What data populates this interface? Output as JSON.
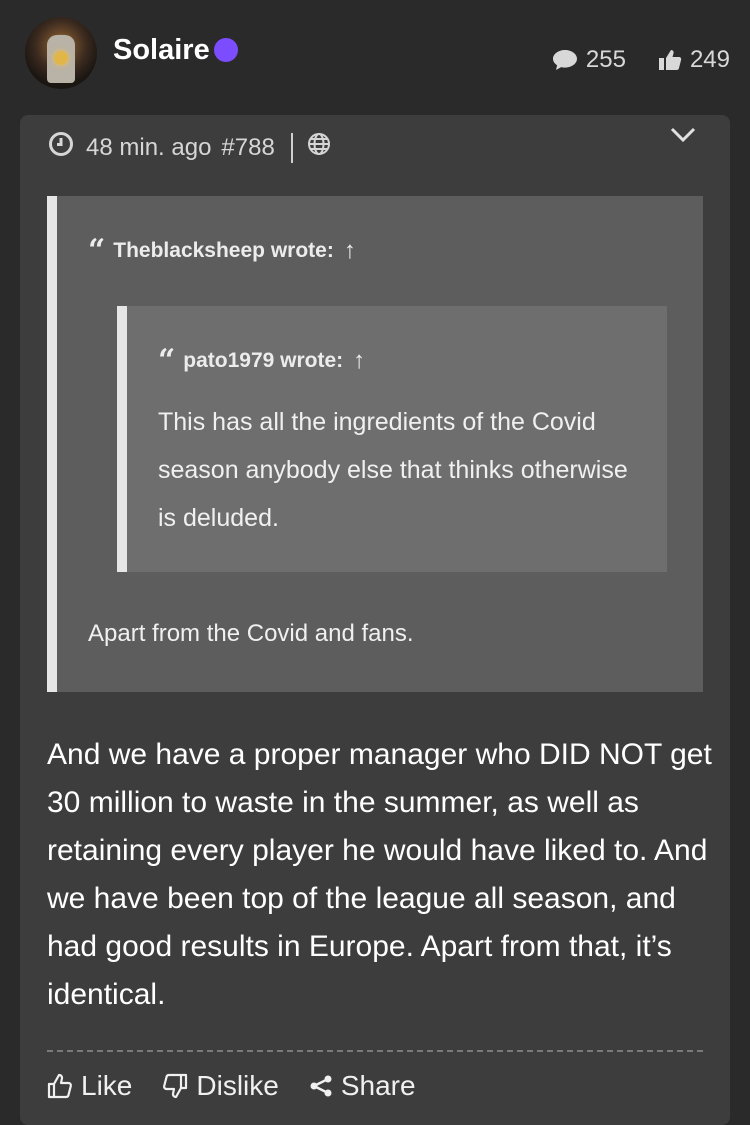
{
  "user": {
    "name": "Solaire"
  },
  "stats": {
    "comments": "255",
    "likes": "249"
  },
  "post": {
    "time": "48 min. ago",
    "number": "#788",
    "quote": {
      "author_line": "Theblacksheep wrote:",
      "arrow": "↑",
      "nested": {
        "author_line": "pato1979 wrote:",
        "arrow": "↑",
        "text": "This has all the ingredients of the Covid season anybody else that thinks otherwise is deluded."
      },
      "reply": "Apart from the Covid and fans."
    },
    "body": "And we have a proper manager who DID NOT get 30 million to waste in the summer, as well as retaining every player he would have liked to. And we have been top of the league all season, and had good results in Europe. Apart from that, it’s identical."
  },
  "actions": {
    "like": "Like",
    "dislike": "Dislike",
    "share": "Share"
  },
  "colors": {
    "status_dot": "#7c4dff",
    "background": "#2a2a2a",
    "card": "#3d3d3d"
  }
}
